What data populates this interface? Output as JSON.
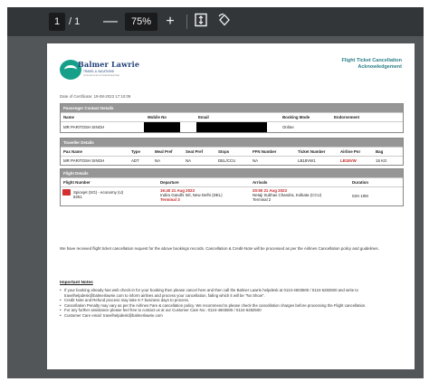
{
  "toolbar": {
    "page_current": "1",
    "page_sep": "/ 1",
    "zoom_out": "—",
    "zoom_level": "75%",
    "zoom_in": "+",
    "fit_icon": "fit-to-page-icon",
    "rotate_icon": "rotate-icon"
  },
  "logo": {
    "name": "Balmer Lawrie",
    "sub": "TRAVEL & VACATIONS",
    "sub2": "(A Government of India Enterprise)"
  },
  "doc": {
    "title_line1": "Flight Ticket Cancellation",
    "title_line2": "Acknowledgement",
    "date": "Date of Certificate: 19-08-2023 17:10:09"
  },
  "passenger": {
    "heading": "Passenger Contact Details",
    "headers": [
      "Name",
      "Mobile No",
      "Email",
      "Booking Mode",
      "Endorsement"
    ],
    "values": [
      "MR PARITOSH SINGH",
      "",
      "",
      "Online",
      ""
    ]
  },
  "traveller": {
    "heading": "Traveller Details",
    "headers": [
      "Pax Name",
      "Type",
      "Meal Pref",
      "Seat Pref",
      "Stops",
      "FFN Number",
      "Ticket Number",
      "Airline Pnr",
      "Bag"
    ],
    "values": [
      "MR PARITOSH SINGH",
      "ADT",
      "NA",
      "NA",
      "DEL/CCU",
      "NA",
      "LB18VW1",
      "LB18VW",
      "15 KG"
    ]
  },
  "flight": {
    "heading": "Flight Details",
    "headers": [
      "Flight Number",
      "Departure",
      "Arrivals",
      "Duration"
    ],
    "airline_line1": "Spicejet (SG) - economy (U)",
    "airline_line2": "8251",
    "dep_time": "16:40 21 Aug 2023",
    "dep_place": "Indira Gandhi Intl, New Delhi (DEL)",
    "dep_terminal": "Terminal 3",
    "arr_time": "20:50 21 Aug 2023",
    "arr_place1": "Netaji Subhas Chandra, Kolkata (CCU)",
    "arr_place2": "Terminal 2",
    "duration": "02H 10M"
  },
  "body": {
    "para": "We have received flight ticket cancellation request for the above bookings records. Cancellation & Credit-Note will be processed as per the Airlines Cancellation policy and guidelines."
  },
  "notes": {
    "heading": "Important Notes",
    "items": [
      "If your booking already has web check-in for your booking then please cancel here and then call the Balmer Lawrie helpdesk at 0124-4603500 / 0124-6282500 and write to travelhelpdesk@balmerlawrie.com to inform airlines and process your cancellation, failing which it will be \"No Show\".",
      "Credit Note and Refund process may take 6-7 business days to process.",
      "Cancellation Penalty may vary as per the Airlines Fare & cancellation policy. We recommend to please check the cancellation charges before processing the Flight cancellation.",
      "For any further assistance please feel free to contact us at our Customer Care No.: 0124-4603500 / 0124-6282500",
      "Customer Care email: travelhelpdesk@balmerlawrie.com"
    ]
  }
}
